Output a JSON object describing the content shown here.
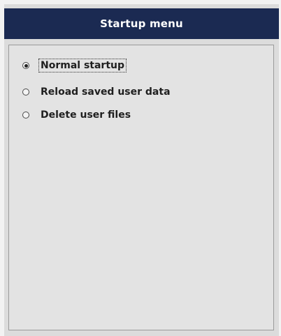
{
  "window": {
    "title": "Startup menu",
    "title_bar_color": "#1b2a52"
  },
  "options": [
    {
      "label": "Normal startup",
      "selected": true,
      "icon": "radio-selected-icon"
    },
    {
      "label": "Reload saved user data",
      "selected": false,
      "icon": "radio-unselected-icon"
    },
    {
      "label": "Delete user files",
      "selected": false,
      "icon": "radio-unselected-icon"
    }
  ]
}
